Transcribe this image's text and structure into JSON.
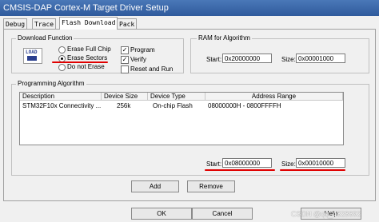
{
  "window": {
    "title": "CMSIS-DAP Cortex-M Target Driver Setup"
  },
  "tabs": [
    {
      "label": "Debug"
    },
    {
      "label": "Trace"
    },
    {
      "label": "Flash Download"
    },
    {
      "label": "Pack"
    }
  ],
  "download_function": {
    "title": "Download Function",
    "logo_text": "LOAD",
    "options": [
      {
        "label": "Erase Full Chip",
        "selected": false
      },
      {
        "label": "Erase Sectors",
        "selected": true
      },
      {
        "label": "Do not Erase",
        "selected": false
      }
    ],
    "checks": [
      {
        "label": "Program",
        "checked": true
      },
      {
        "label": "Verify",
        "checked": true
      },
      {
        "label": "Reset and Run",
        "checked": false
      }
    ]
  },
  "ram": {
    "title": "RAM for Algorithm",
    "start_label": "Start:",
    "start_value": "0x20000000",
    "size_label": "Size:",
    "size_value": "0x00001000"
  },
  "algorithm": {
    "title": "Programming Algorithm",
    "columns": [
      "Description",
      "Device Size",
      "Device Type",
      "Address Range"
    ],
    "rows": [
      [
        "STM32F10x Connectivity ...",
        "256k",
        "On-chip Flash",
        "08000000H - 0800FFFFH"
      ]
    ],
    "start_label": "Start:",
    "start_value": "0x08000000",
    "size_label": "Size:",
    "size_value": "0x00010000"
  },
  "buttons": {
    "add": "Add",
    "remove": "Remove"
  },
  "footer": {
    "ok": "OK",
    "cancel": "Cancel",
    "help": "Help"
  },
  "watermark": "CSDN @qq_4828692",
  "colors": {
    "annotation": "#e00000",
    "title_bar": "#3a68aa"
  },
  "check_mark": "✓"
}
